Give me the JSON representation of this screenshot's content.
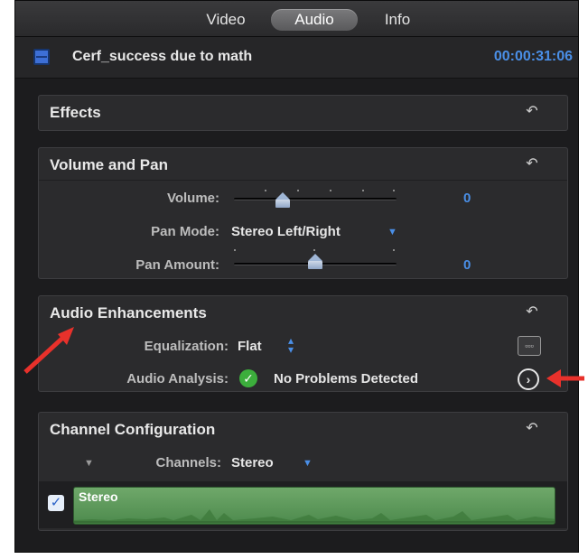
{
  "tabs": [
    {
      "label": "Video",
      "active": false
    },
    {
      "label": "Audio",
      "active": true
    },
    {
      "label": "Info",
      "active": false
    }
  ],
  "clip": {
    "name": "Cerf_success due to math",
    "timecode": "00:00:31:06"
  },
  "panels": {
    "effects": {
      "title": "Effects"
    },
    "volume_pan": {
      "title": "Volume and Pan",
      "volume_label": "Volume:",
      "volume_value": "0",
      "volume_level": 0.3,
      "pan_mode_label": "Pan Mode:",
      "pan_mode_value": "Stereo Left/Right",
      "pan_amount_label": "Pan Amount:",
      "pan_amount_value": "0",
      "pan_amount_level": 0.5
    },
    "audio_enhancements": {
      "title": "Audio Enhancements",
      "equalization_label": "Equalization:",
      "equalization_value": "Flat",
      "analysis_label": "Audio Analysis:",
      "analysis_value": "No Problems Detected"
    },
    "channel_configuration": {
      "title": "Channel Configuration",
      "channels_label": "Channels:",
      "channels_value": "Stereo",
      "lane_label": "Stereo",
      "lane_checked": true
    }
  },
  "colors": {
    "accent": "#4a8fe7",
    "waveform": "#5c9a58",
    "annotation": "#e8312b",
    "status_ok": "#3cae3c"
  },
  "icons": {
    "reset": "reset-arrow-icon",
    "clip": "audio-clip-icon",
    "check": "checkmark-icon",
    "go": "chevron-right-circle-icon",
    "eq": "equalizer-icon"
  }
}
